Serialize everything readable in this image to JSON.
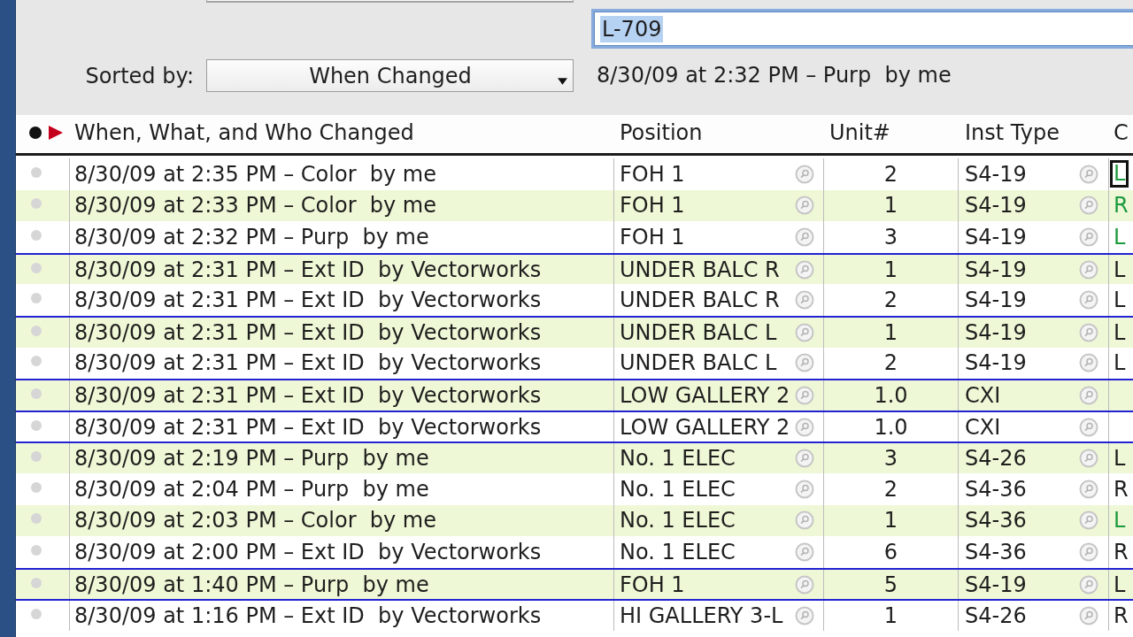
{
  "sort": {
    "label": "Sorted by:",
    "value": "When Changed"
  },
  "id_field": {
    "value": "L-709",
    "text_selected": true
  },
  "change_summary": "8/30/09 at 2:32 PM – Purp  by me",
  "table": {
    "columns": [
      {
        "label": "When, What, and Who Changed"
      },
      {
        "label": "Position"
      },
      {
        "label": "Unit#"
      },
      {
        "label": "Inst Type"
      },
      {
        "label": "C"
      }
    ],
    "rows": [
      {
        "change": "8/30/09 at 2:35 PM – Color  by me",
        "position": "FOH 1",
        "unit": "2",
        "inst_type": "S4-19",
        "column_5": {
          "text": "L",
          "highlighted": true,
          "focused": true
        },
        "divider_above": false
      },
      {
        "change": "8/30/09 at 2:33 PM – Color  by me",
        "position": "FOH 1",
        "unit": "1",
        "inst_type": "S4-19",
        "column_5": {
          "text": "R",
          "highlighted": true,
          "focused": false
        },
        "divider_above": false
      },
      {
        "change": "8/30/09 at 2:32 PM – Purp  by me",
        "position": "FOH 1",
        "unit": "3",
        "inst_type": "S4-19",
        "column_5": {
          "text": "L",
          "highlighted": true,
          "focused": false
        },
        "divider_above": false
      },
      {
        "change": "8/30/09 at 2:31 PM – Ext ID  by Vectorworks",
        "position": "UNDER BALC R",
        "unit": "1",
        "inst_type": "S4-19",
        "column_5": {
          "text": "L",
          "highlighted": false,
          "focused": false
        },
        "divider_above": true
      },
      {
        "change": "8/30/09 at 2:31 PM – Ext ID  by Vectorworks",
        "position": "UNDER BALC R",
        "unit": "2",
        "inst_type": "S4-19",
        "column_5": {
          "text": "L",
          "highlighted": false,
          "focused": false
        },
        "divider_above": false
      },
      {
        "change": "8/30/09 at 2:31 PM – Ext ID  by Vectorworks",
        "position": "UNDER BALC L",
        "unit": "1",
        "inst_type": "S4-19",
        "column_5": {
          "text": "L",
          "highlighted": false,
          "focused": false
        },
        "divider_above": true
      },
      {
        "change": "8/30/09 at 2:31 PM – Ext ID  by Vectorworks",
        "position": "UNDER BALC L",
        "unit": "2",
        "inst_type": "S4-19",
        "column_5": {
          "text": "L",
          "highlighted": false,
          "focused": false
        },
        "divider_above": false
      },
      {
        "change": "8/30/09 at 2:31 PM – Ext ID  by Vectorworks",
        "position": "LOW GALLERY 2",
        "unit": "1.0",
        "inst_type": "CXI",
        "divider_above": true
      },
      {
        "change": "8/30/09 at 2:31 PM – Ext ID  by Vectorworks",
        "position": "LOW GALLERY 2",
        "unit": "1.0",
        "inst_type": "CXI",
        "divider_above": true
      },
      {
        "change": "8/30/09 at 2:19 PM – Purp  by me",
        "position": "No. 1 ELEC",
        "unit": "3",
        "inst_type": "S4-26",
        "column_5": {
          "text": "L",
          "highlighted": false,
          "focused": false
        },
        "divider_above": true
      },
      {
        "change": "8/30/09 at 2:04 PM – Purp  by me",
        "position": "No. 1 ELEC",
        "unit": "2",
        "inst_type": "S4-36",
        "column_5": {
          "text": "R",
          "highlighted": false,
          "focused": false
        },
        "divider_above": false
      },
      {
        "change": "8/30/09 at 2:03 PM – Color  by me",
        "position": "No. 1 ELEC",
        "unit": "1",
        "inst_type": "S4-36",
        "column_5": {
          "text": "L",
          "highlighted": true,
          "focused": false
        },
        "divider_above": false
      },
      {
        "change": "8/30/09 at 2:00 PM – Ext ID  by Vectorworks",
        "position": "No. 1 ELEC",
        "unit": "6",
        "inst_type": "S4-36",
        "column_5": {
          "text": "R",
          "highlighted": false,
          "focused": false
        },
        "divider_above": false
      },
      {
        "change": "8/30/09 at 1:40 PM – Purp  by me",
        "position": "FOH 1",
        "unit": "5",
        "inst_type": "S4-19",
        "column_5": {
          "text": "L",
          "highlighted": false,
          "focused": false
        },
        "divider_above": true
      },
      {
        "change": "8/30/09 at 1:16 PM – Ext ID  by Vectorworks",
        "position": "HI GALLERY 3-L",
        "unit": "1",
        "inst_type": "S4-26",
        "column_5": {
          "text": "R",
          "highlighted": false,
          "focused": false
        },
        "divider_above": true
      }
    ]
  }
}
